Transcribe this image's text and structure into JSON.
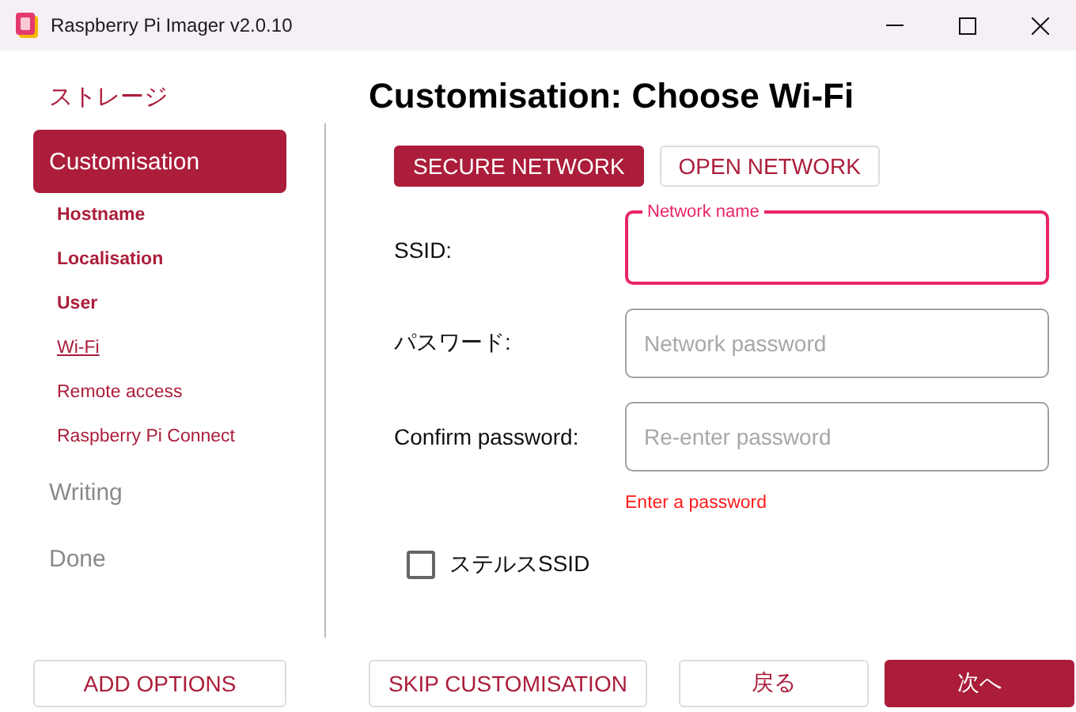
{
  "window": {
    "title": "Raspberry Pi Imager v2.0.10"
  },
  "sidebar": {
    "steps": [
      {
        "label": "ストレージ",
        "completed": true,
        "selected": false
      },
      {
        "label": "Customisation",
        "completed": false,
        "selected": true,
        "substeps": [
          {
            "label": "Hostname",
            "completed": true,
            "selected": false
          },
          {
            "label": "Localisation",
            "completed": true,
            "selected": false
          },
          {
            "label": "User",
            "completed": true,
            "selected": false
          },
          {
            "label": "Wi-Fi",
            "completed": false,
            "selected": true
          },
          {
            "label": "Remote access",
            "completed": false,
            "selected": false
          },
          {
            "label": "Raspberry Pi Connect",
            "completed": false,
            "selected": false
          }
        ]
      },
      {
        "label": "Writing",
        "completed": false,
        "selected": false
      },
      {
        "label": "Done",
        "completed": false,
        "selected": false
      }
    ]
  },
  "heading": "Customisation: Choose Wi-Fi",
  "network_tabs": [
    {
      "label": "SECURE NETWORK",
      "selected": true
    },
    {
      "label": "OPEN NETWORK",
      "selected": false
    }
  ],
  "fields": [
    {
      "label": "SSID:",
      "floating_label": "Network name",
      "focused": true
    },
    {
      "label": "パスワード:",
      "placeholder": "Network password",
      "focused": false
    },
    {
      "label": "Confirm password:",
      "placeholder": "Re-enter password",
      "focused": false
    }
  ],
  "error": "Enter a password",
  "hidden_ssid": {
    "label": "ステルスSSID",
    "checked": false
  },
  "buttons": [
    {
      "label": "ADD OPTIONS",
      "primary": false
    },
    {
      "label": "SKIP CUSTOMISATION",
      "primary": false
    },
    {
      "label": "戻る",
      "primary": false
    },
    {
      "label": "次へ",
      "primary": true
    }
  ]
}
